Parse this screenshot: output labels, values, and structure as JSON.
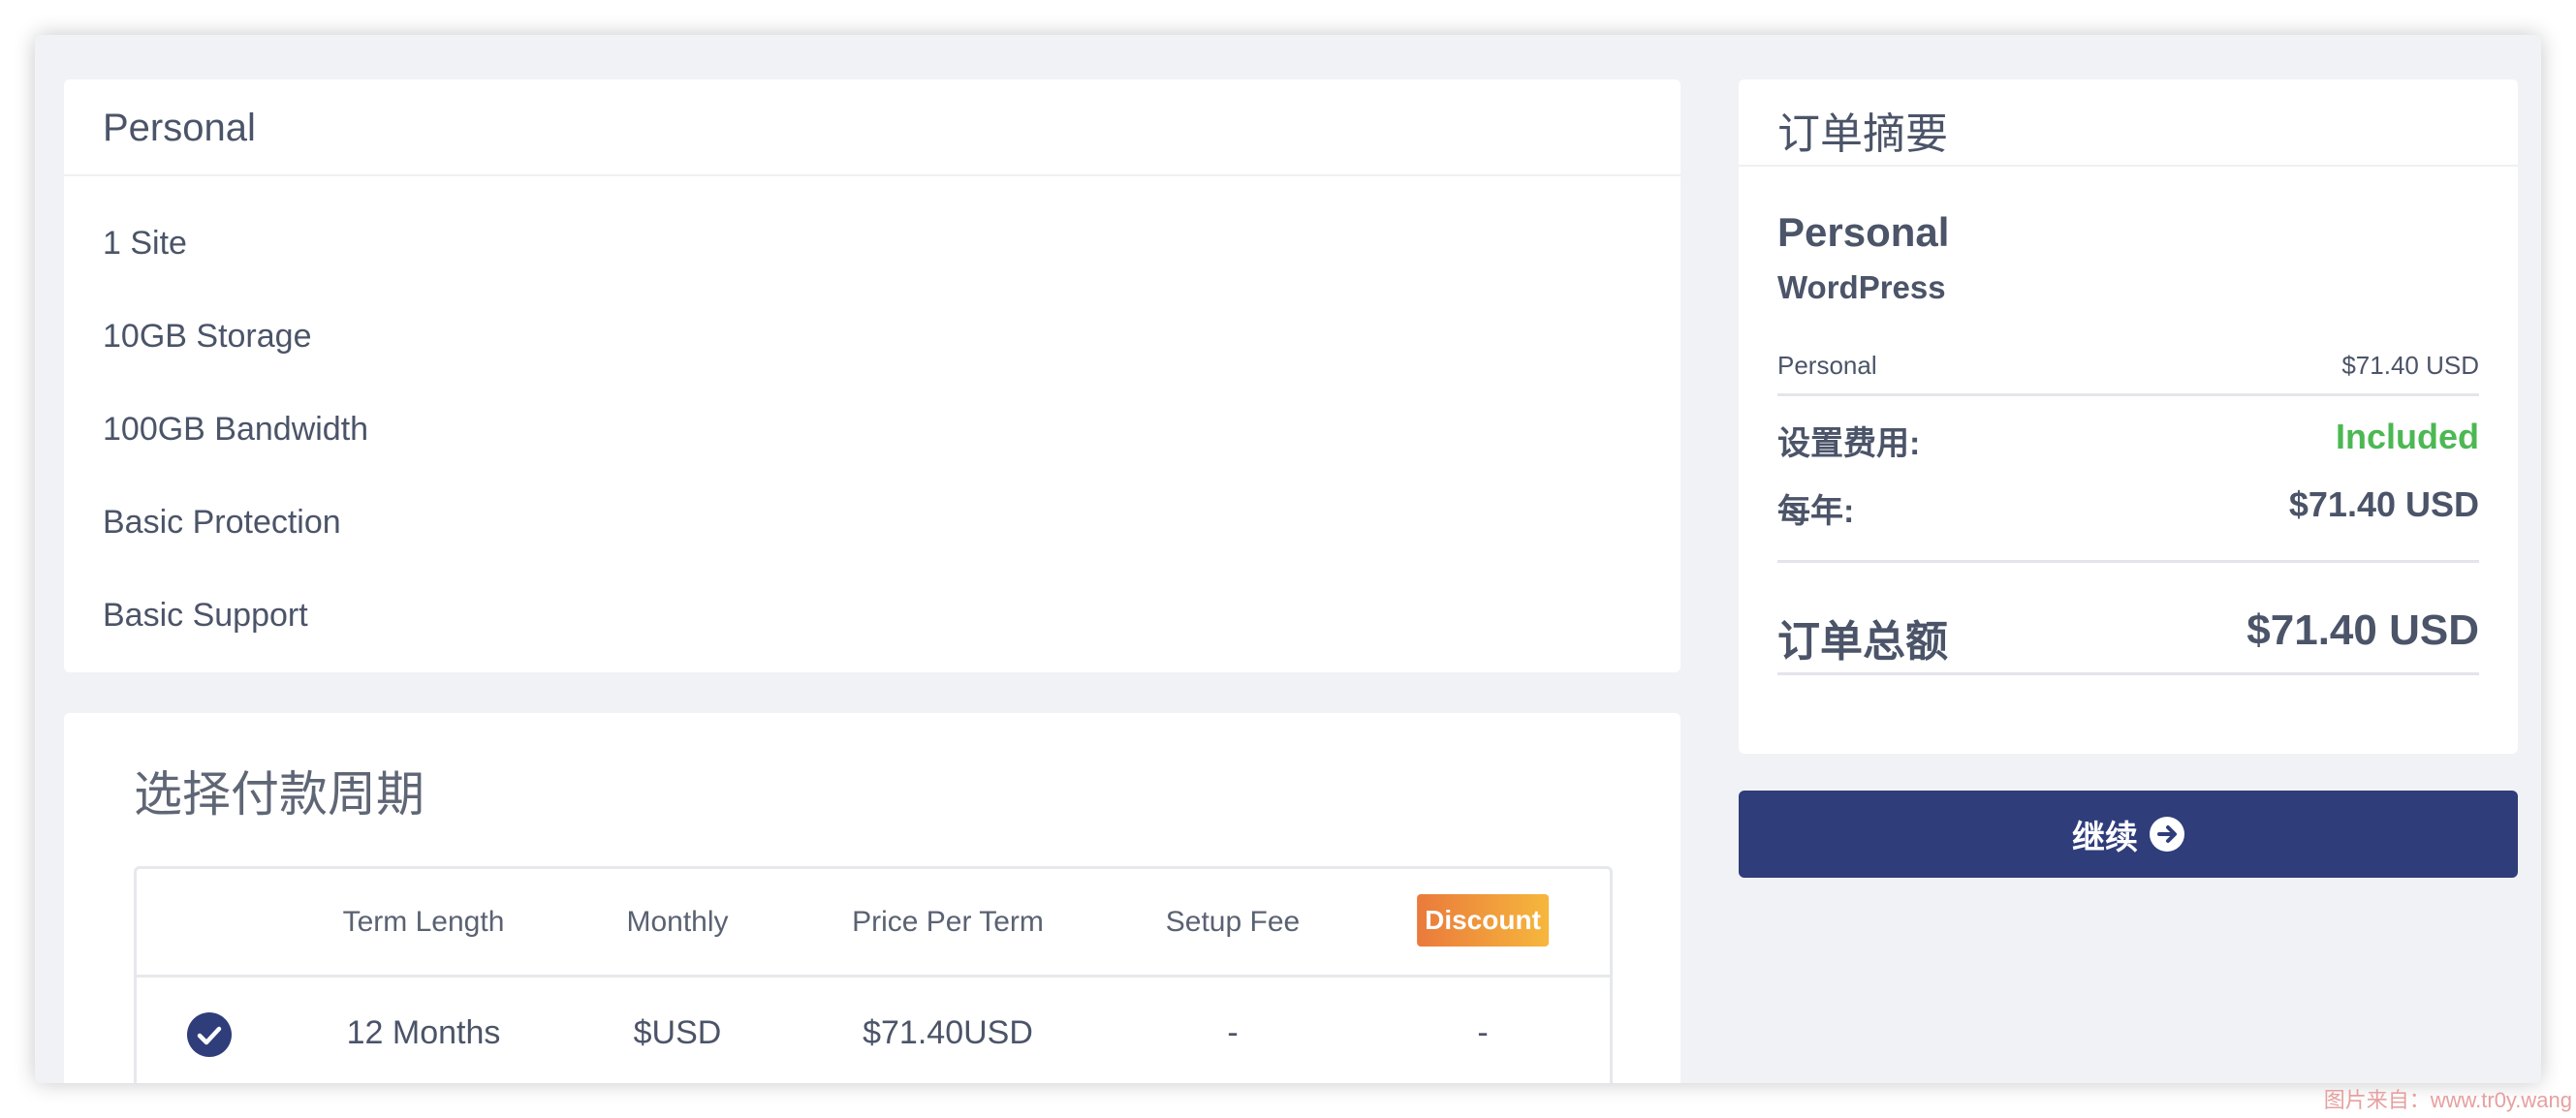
{
  "features": {
    "title": "Personal",
    "items": [
      {
        "label": "1 Site"
      },
      {
        "label": "10GB Storage"
      },
      {
        "label": "100GB Bandwidth"
      },
      {
        "label": "Basic Protection"
      },
      {
        "label": "Basic Support"
      }
    ]
  },
  "billing": {
    "title": "选择付款周期",
    "headers": {
      "term_length": "Term Length",
      "monthly": "Monthly",
      "price_per_term": "Price Per Term",
      "setup_fee": "Setup Fee",
      "discount": "Discount"
    },
    "rows": [
      {
        "selected": true,
        "term_length": "12 Months",
        "monthly": "$USD",
        "price_per_term": "$71.40USD",
        "setup_fee": "-",
        "discount": "-"
      }
    ]
  },
  "summary": {
    "title": "订单摘要",
    "product_name": "Personal",
    "product_group": "WordPress",
    "line_item_label": "Personal",
    "line_item_price": "$71.40 USD",
    "setup_label": "设置费用:",
    "setup_value": "Included",
    "annual_label": "每年:",
    "annual_value": "$71.40 USD",
    "total_label": "订单总额",
    "total_value": "$71.40 USD"
  },
  "actions": {
    "continue_label": "继续"
  },
  "watermark": "图片来自：www.tr0y.wang",
  "colors": {
    "primary": "#2f3d7b",
    "included_green": "#4cb853",
    "discount_start": "#ea7a3c",
    "discount_end": "#f6b73c",
    "background": "#f1f2f5"
  }
}
